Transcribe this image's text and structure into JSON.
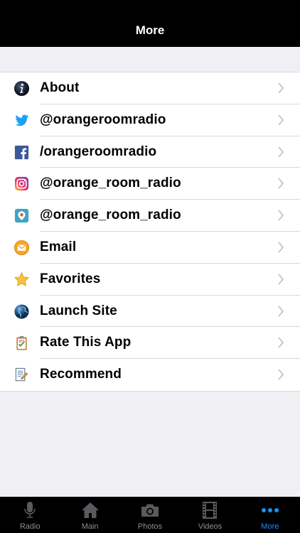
{
  "navbar": {
    "title": "More"
  },
  "menu": {
    "items": [
      {
        "label": "About",
        "icon": "info-icon"
      },
      {
        "label": "@orangeroomradio",
        "icon": "twitter-icon"
      },
      {
        "label": "/orangeroomradio",
        "icon": "facebook-icon"
      },
      {
        "label": "@orange_room_radio",
        "icon": "instagram-icon"
      },
      {
        "label": "@orange_room_radio",
        "icon": "periscope-icon"
      },
      {
        "label": "Email",
        "icon": "email-icon"
      },
      {
        "label": "Favorites",
        "icon": "star-icon"
      },
      {
        "label": "Launch Site",
        "icon": "globe-icon"
      },
      {
        "label": "Rate This App",
        "icon": "clipboard-check-icon"
      },
      {
        "label": "Recommend",
        "icon": "document-pencil-icon"
      }
    ]
  },
  "tabbar": {
    "tabs": [
      {
        "label": "Radio",
        "icon": "microphone-icon",
        "active": false
      },
      {
        "label": "Main",
        "icon": "home-icon",
        "active": false
      },
      {
        "label": "Photos",
        "icon": "camera-icon",
        "active": false
      },
      {
        "label": "Videos",
        "icon": "film-icon",
        "active": false
      },
      {
        "label": "More",
        "icon": "more-dots-icon",
        "active": true
      }
    ]
  },
  "colors": {
    "accent": "#1e8ef7",
    "inactive": "#8e8e93",
    "bar": "#000000",
    "background": "#efeff4"
  }
}
